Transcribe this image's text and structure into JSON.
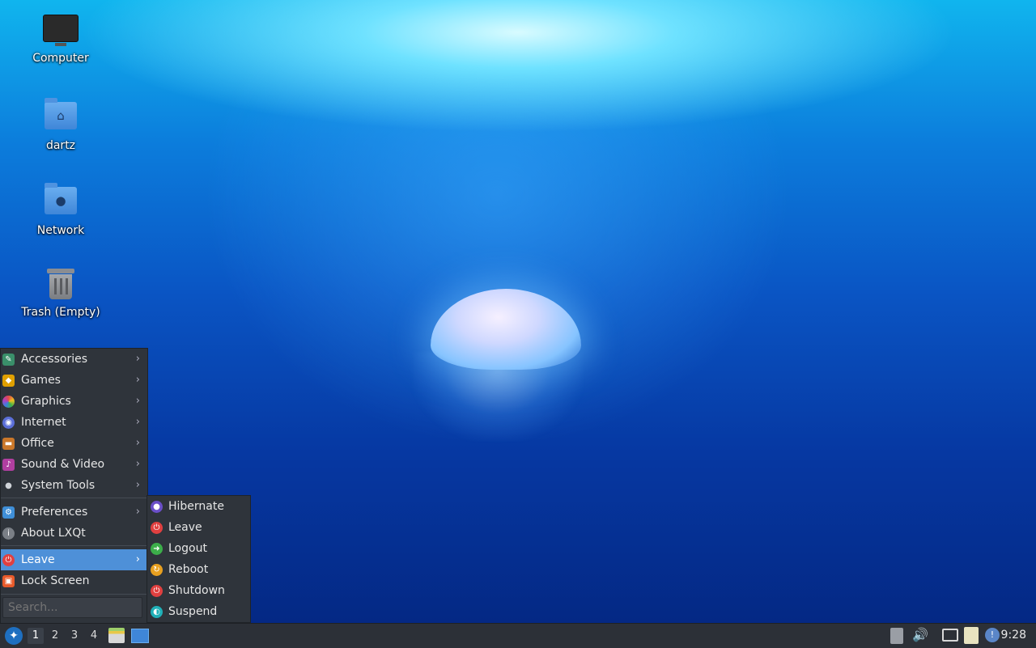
{
  "desktop": {
    "icons": [
      {
        "label": "Computer"
      },
      {
        "label": "dartz"
      },
      {
        "label": "Network"
      },
      {
        "label": "Trash (Empty)"
      }
    ]
  },
  "menu": {
    "items": [
      {
        "label": "Accessories",
        "icon": "accessories-icon",
        "color": "#3a8f6a"
      },
      {
        "label": "Games",
        "icon": "games-icon",
        "color": "#e0a000"
      },
      {
        "label": "Graphics",
        "icon": "graphics-icon",
        "color": "#d9584a"
      },
      {
        "label": "Internet",
        "icon": "internet-icon",
        "color": "#5b6fd8"
      },
      {
        "label": "Office",
        "icon": "office-icon",
        "color": "#c9772a"
      },
      {
        "label": "Sound & Video",
        "icon": "sound-video-icon",
        "color": "#b03fa0"
      },
      {
        "label": "System Tools",
        "icon": "system-tools-icon",
        "color": "#cfd3d8"
      },
      {
        "label": "Preferences",
        "icon": "preferences-icon",
        "color": "#3f8fd8"
      },
      {
        "label": "About LXQt",
        "icon": "about-icon",
        "color": "#7a7f86"
      },
      {
        "label": "Leave",
        "icon": "leave-icon",
        "color": "#e04040"
      },
      {
        "label": "Lock Screen",
        "icon": "lock-icon",
        "color": "#e85a2a"
      }
    ],
    "search_placeholder": "Search..."
  },
  "submenu": {
    "items": [
      {
        "label": "Hibernate",
        "icon": "hibernate-icon",
        "color": "#6a4fc8"
      },
      {
        "label": "Leave",
        "icon": "leave-icon",
        "color": "#e04040"
      },
      {
        "label": "Logout",
        "icon": "logout-icon",
        "color": "#3cae4a"
      },
      {
        "label": "Reboot",
        "icon": "reboot-icon",
        "color": "#e8a020"
      },
      {
        "label": "Shutdown",
        "icon": "shutdown-icon",
        "color": "#e04040"
      },
      {
        "label": "Suspend",
        "icon": "suspend-icon",
        "color": "#20b0b8"
      }
    ]
  },
  "taskbar": {
    "workspaces": [
      "1",
      "2",
      "3",
      "4"
    ],
    "clock": "9:28"
  }
}
